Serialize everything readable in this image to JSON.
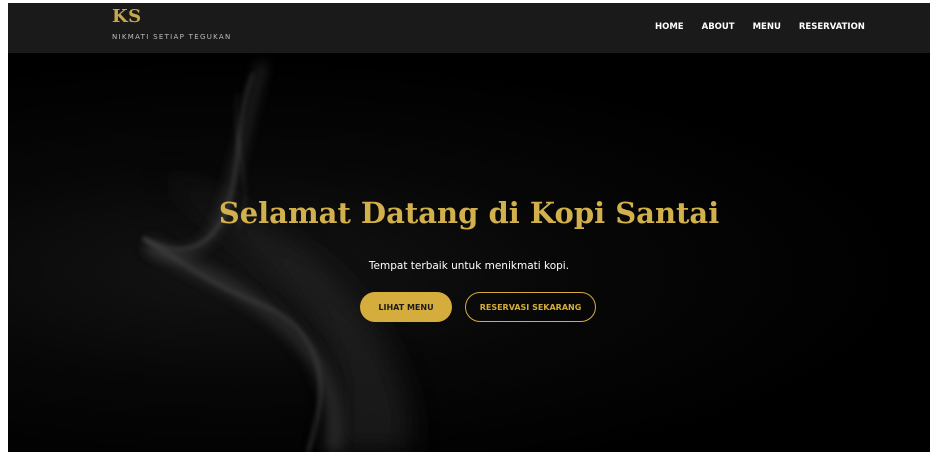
{
  "brand": {
    "logo": "KS",
    "tagline": "NIKMATI SETIAP TEGUKAN"
  },
  "nav": {
    "items": [
      "HOME",
      "ABOUT",
      "MENU",
      "RESERVATION"
    ]
  },
  "hero": {
    "title": "Selamat Datang di Kopi Santai",
    "subtitle": "Tempat terbaik untuk menikmati kopi.",
    "primary_button": "LIHAT MENU",
    "secondary_button": "RESERVASI SEKARANG"
  },
  "colors": {
    "accent": "#d4ad3c",
    "navbar_bg": "#1a1a1a",
    "hero_bg": "#000000"
  }
}
